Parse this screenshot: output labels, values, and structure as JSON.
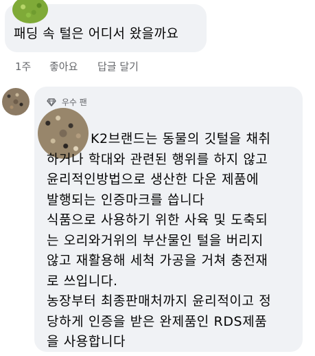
{
  "top_comment": {
    "text": "패딩 속 털은 어디서 왔을까요"
  },
  "actions": {
    "time": "1주",
    "like": "좋아요",
    "reply": "답글 달기"
  },
  "reply_comment": {
    "badge": "우수 팬",
    "badge_icon": "diamond-icon",
    "lines": [
      "K2브랜드는 동물의 깃털을 채취",
      "하거나 학대와 관련된 행위를 하지 않고",
      "윤리적인방법으로 생산한 다운 제품에",
      "발행되는 인증마크를 씁니다",
      "식품으로 사용하기 위한 사육 및 도축되",
      "는 오리와거위의 부산물인 털을 버리지",
      "않고 재활용해 세척 가공을 거쳐 충전재",
      "로 쓰입니다.",
      "농장부터 최종판매처까지 윤리적이고 정",
      "당하게 인증을 받은 완제품인 RDS제품",
      "을 사용합니다"
    ]
  },
  "colors": {
    "bubble": "#f0f2f5",
    "text": "#050505",
    "secondary": "#65676b"
  }
}
